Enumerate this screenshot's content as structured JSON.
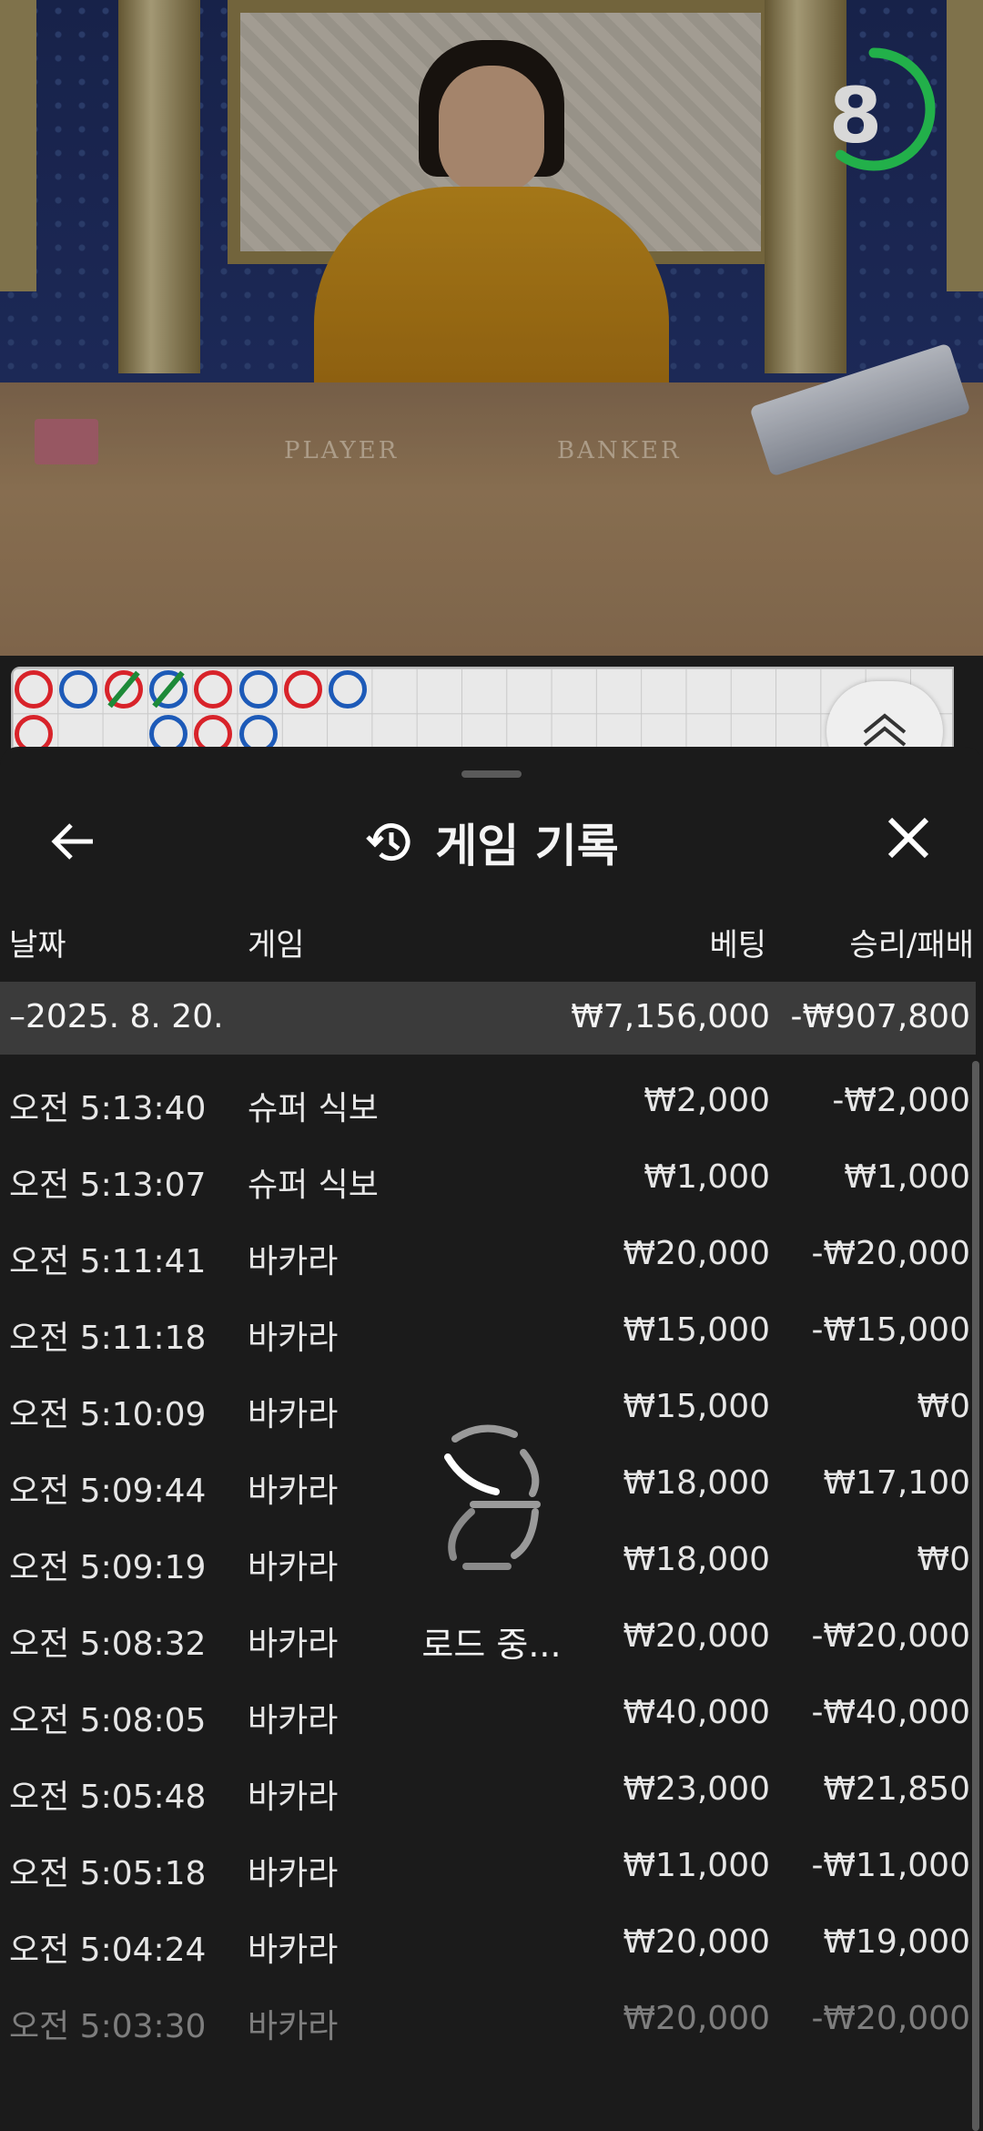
{
  "timer": {
    "value": "8",
    "progress": 0.6
  },
  "roadmap": {
    "beads": [
      {
        "col": 0,
        "row": 0,
        "color": "r",
        "slash": false
      },
      {
        "col": 1,
        "row": 0,
        "color": "b",
        "slash": false
      },
      {
        "col": 2,
        "row": 0,
        "color": "r",
        "slash": true
      },
      {
        "col": 3,
        "row": 0,
        "color": "b",
        "slash": true
      },
      {
        "col": 4,
        "row": 0,
        "color": "r",
        "slash": false
      },
      {
        "col": 5,
        "row": 0,
        "color": "b",
        "slash": false
      },
      {
        "col": 6,
        "row": 0,
        "color": "r",
        "slash": false
      },
      {
        "col": 7,
        "row": 0,
        "color": "b",
        "slash": false
      },
      {
        "col": 0,
        "row": 1,
        "color": "r",
        "slash": false
      },
      {
        "col": 3,
        "row": 1,
        "color": "b",
        "slash": false
      },
      {
        "col": 4,
        "row": 1,
        "color": "r",
        "slash": false
      },
      {
        "col": 5,
        "row": 1,
        "color": "b",
        "slash": false
      }
    ]
  },
  "sheet": {
    "title": "게임 기록",
    "columns": {
      "date": "날짜",
      "game": "게임",
      "bet": "베팅",
      "winloss": "승리/패배"
    },
    "date_group": {
      "date": "–2025. 8. 20.",
      "bet": "₩7,156,000",
      "winloss": "-₩907,800"
    },
    "rows": [
      {
        "time": "오전 5:13:40",
        "game": "슈퍼 식보",
        "bet": "₩2,000",
        "winloss": "-₩2,000"
      },
      {
        "time": "오전 5:13:07",
        "game": "슈퍼 식보",
        "bet": "₩1,000",
        "winloss": "₩1,000"
      },
      {
        "time": "오전 5:11:41",
        "game": "바카라",
        "bet": "₩20,000",
        "winloss": "-₩20,000"
      },
      {
        "time": "오전 5:11:18",
        "game": "바카라",
        "bet": "₩15,000",
        "winloss": "-₩15,000"
      },
      {
        "time": "오전 5:10:09",
        "game": "바카라",
        "bet": "₩15,000",
        "winloss": "₩0"
      },
      {
        "time": "오전 5:09:44",
        "game": "바카라",
        "bet": "₩18,000",
        "winloss": "₩17,100"
      },
      {
        "time": "오전 5:09:19",
        "game": "바카라",
        "bet": "₩18,000",
        "winloss": "₩0"
      },
      {
        "time": "오전 5:08:32",
        "game": "바카라",
        "bet": "₩20,000",
        "winloss": "-₩20,000"
      },
      {
        "time": "오전 5:08:05",
        "game": "바카라",
        "bet": "₩40,000",
        "winloss": "-₩40,000"
      },
      {
        "time": "오전 5:05:48",
        "game": "바카라",
        "bet": "₩23,000",
        "winloss": "₩21,850"
      },
      {
        "time": "오전 5:05:18",
        "game": "바카라",
        "bet": "₩11,000",
        "winloss": "-₩11,000"
      },
      {
        "time": "오전 5:04:24",
        "game": "바카라",
        "bet": "₩20,000",
        "winloss": "₩19,000"
      },
      {
        "time": "오전 5:03:30",
        "game": "바카라",
        "bet": "₩20,000",
        "winloss": "-₩20,000"
      }
    ],
    "loading_text": "로드 중..."
  },
  "table_labels": {
    "player": "PLAYER",
    "banker": "BANKER"
  },
  "colors": {
    "timer_green": "#22b04a",
    "sheet_bg": "#1b1b1b",
    "date_row_bg": "#3b3b3b"
  }
}
